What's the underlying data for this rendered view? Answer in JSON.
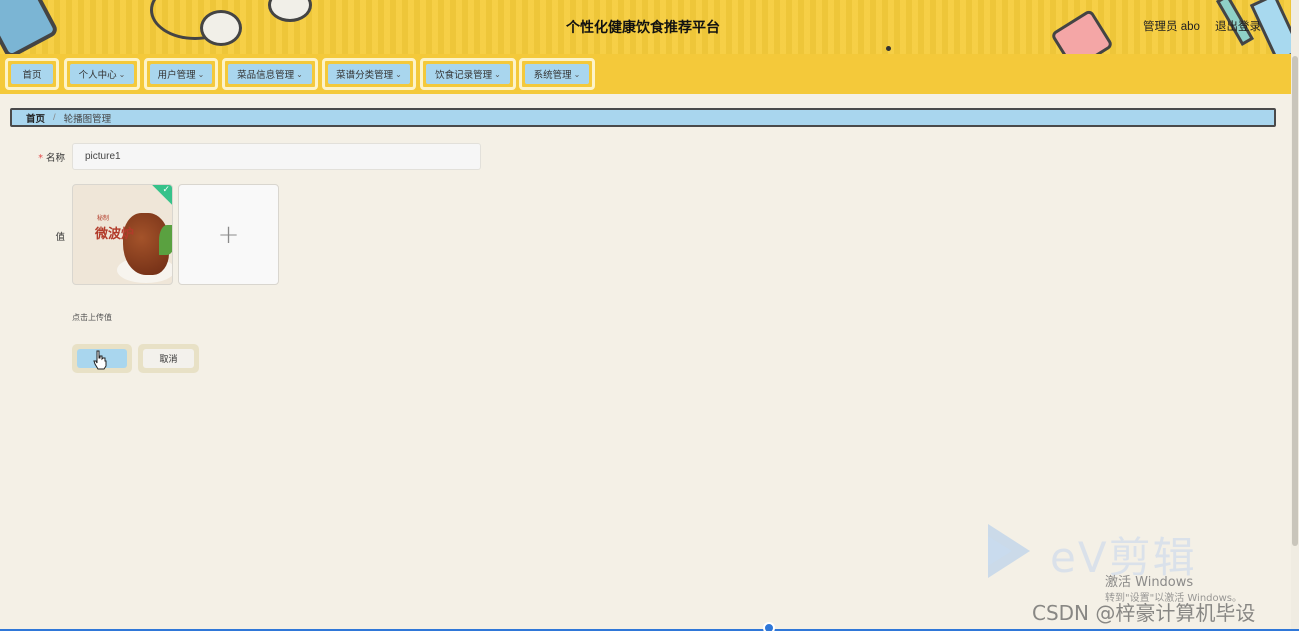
{
  "header": {
    "site_title": "个性化健康饮食推荐平台",
    "user_label": "管理员 abo",
    "logout_label": "退出登录",
    "bg_color": "#f6cc3b"
  },
  "nav": {
    "items": [
      {
        "label": "首页",
        "has_dropdown": false
      },
      {
        "label": "个人中心",
        "has_dropdown": true
      },
      {
        "label": "用户管理",
        "has_dropdown": true
      },
      {
        "label": "菜品信息管理",
        "has_dropdown": true
      },
      {
        "label": "菜谱分类管理",
        "has_dropdown": true
      },
      {
        "label": "饮食记录管理",
        "has_dropdown": true
      },
      {
        "label": "系统管理",
        "has_dropdown": true
      }
    ],
    "item_color": "#a9d6ee",
    "dropdown_icon": "chevron-down-icon"
  },
  "breadcrumb": {
    "home": "首页",
    "separator": "/",
    "current": "轮播图管理"
  },
  "form": {
    "name_label": "名称",
    "required_mark": "*",
    "name_value": "picture1",
    "value_label": "值",
    "thumb_text_small": "秘制",
    "thumb_text_big": "微波炉",
    "upload_icon": "plus-icon",
    "upload_symbol": "+",
    "upload_hint": "点击上传值",
    "uploaded_check": "✓",
    "submit_label": "",
    "cancel_label": "取消"
  },
  "watermarks": {
    "ev_text": "eV剪辑",
    "activate_line1": "激活 Windows",
    "activate_line2": "转到\"设置\"以激活 Windows。",
    "csdn_text": "CSDN @梓豪计算机毕设"
  }
}
